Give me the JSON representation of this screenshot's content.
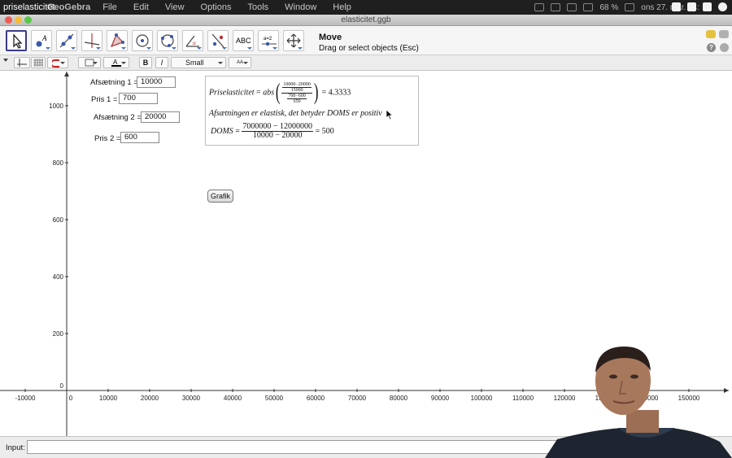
{
  "video": {
    "title": "priselasticitet"
  },
  "menubar": {
    "app": "GeoGebra",
    "menus": [
      "File",
      "Edit",
      "View",
      "Options",
      "Tools",
      "Window",
      "Help"
    ],
    "battery": "68 %",
    "clock": "ons 27. mar. 14:"
  },
  "window": {
    "title": "elasticitet.ggb"
  },
  "toolbar": {
    "help_title": "Move",
    "help_text": "Drag or select objects (Esc)",
    "text_tool_label": "ABC",
    "slider_tool_label": "a=2"
  },
  "stylebar": {
    "bold": "B",
    "italic": "I",
    "size": "Small",
    "font_size_label": "AA"
  },
  "boxes": [
    {
      "label": "Afsætning 1 =",
      "value": "10000"
    },
    {
      "label": "Pris 1 =",
      "value": "700"
    },
    {
      "label": "Afsætning 2 =",
      "value": "20000"
    },
    {
      "label": "Pris 2 =",
      "value": "600"
    }
  ],
  "text_panel": {
    "l1_name": "Priselasticitet",
    "l1_eq": "=",
    "l1_fn": "abs",
    "l1_num_num": "10000−20000",
    "l1_num_den": "15000",
    "l1_den_num": "700−600",
    "l1_den_den": "650",
    "l1_result": "= 4.3333",
    "l2": "Afsætningen er elastisk, det betyder DOMS er positiv",
    "l3_name": "DOMS",
    "l3_eq": "=",
    "l3_num": "7000000 − 12000000",
    "l3_den": "10000 − 20000",
    "l3_result": "= 500"
  },
  "button": {
    "grafik": "Grafik"
  },
  "axes": {
    "x_ticks": [
      "-10000",
      "0",
      "10000",
      "20000",
      "30000",
      "40000",
      "50000",
      "60000",
      "70000",
      "80000",
      "90000",
      "100000",
      "110000",
      "120000",
      "130000",
      "140000",
      "150000"
    ],
    "y_ticks": [
      "0",
      "200",
      "400",
      "600",
      "800",
      "1000"
    ]
  },
  "inputbar": {
    "label": "Input:"
  }
}
